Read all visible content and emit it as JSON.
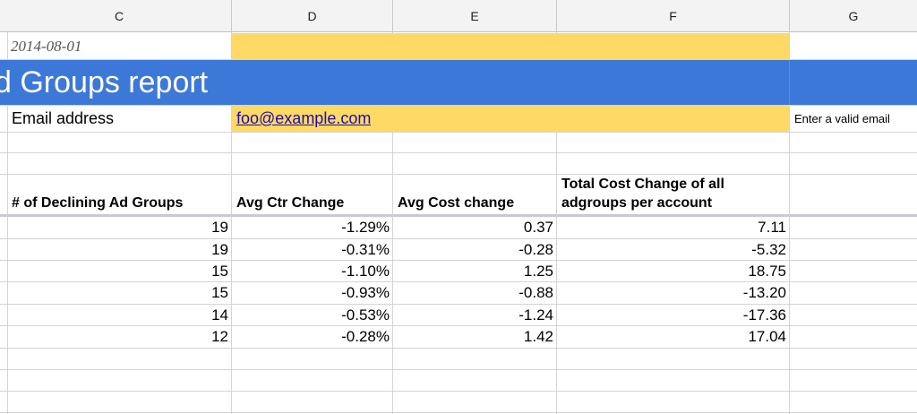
{
  "columns": [
    "C",
    "D",
    "E",
    "F",
    "G"
  ],
  "report": {
    "date": "2014-08-01",
    "title": "d Groups report",
    "email_label": "Email address",
    "email_value": "foo@example.com",
    "email_hint": "Enter a valid email"
  },
  "colors": {
    "banner": "#3c78d8",
    "highlight": "#ffd966",
    "link": "#1a0dab"
  },
  "table": {
    "headers": {
      "declining": "# of Declining Ad Groups",
      "ctr": "Avg Ctr Change",
      "cost": "Avg Cost change",
      "total_line1": "Total Cost Change of all",
      "total_line2": "adgroups per account"
    },
    "rows": [
      {
        "declining": "19",
        "ctr": "-1.29%",
        "cost": "0.37",
        "total": "7.11"
      },
      {
        "declining": "19",
        "ctr": "-0.31%",
        "cost": "-0.28",
        "total": "-5.32"
      },
      {
        "declining": "15",
        "ctr": "-1.10%",
        "cost": "1.25",
        "total": "18.75"
      },
      {
        "declining": "15",
        "ctr": "-0.93%",
        "cost": "-0.88",
        "total": "-13.20"
      },
      {
        "declining": "14",
        "ctr": "-0.53%",
        "cost": "-1.24",
        "total": "-17.36"
      },
      {
        "declining": "12",
        "ctr": "-0.28%",
        "cost": "1.42",
        "total": "17.04"
      }
    ]
  }
}
